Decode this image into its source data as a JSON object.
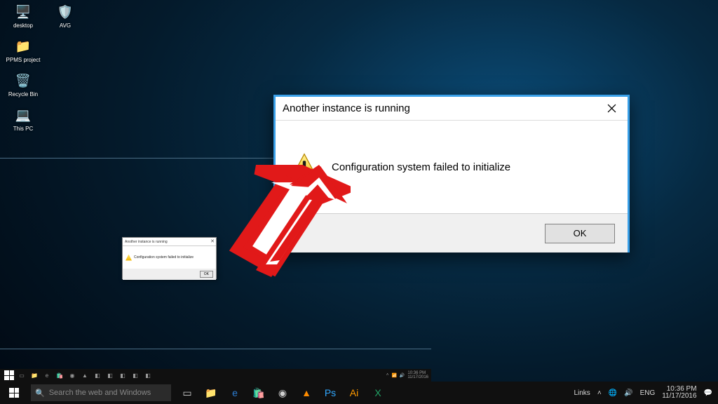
{
  "dialog": {
    "title": "Another instance is running",
    "message": "Configuration system failed to initialize",
    "ok_label": "OK"
  },
  "mini_dialog": {
    "title": "Another instance is running",
    "message": "Configuration system failed to initialize",
    "ok_label": "OK"
  },
  "desktop": {
    "col1": [
      "desktop",
      "PPMS project",
      "Recycle Bin",
      "This PC"
    ],
    "col2": [
      "AVG"
    ]
  },
  "outer_taskbar": {
    "search_placeholder": "Search the web and Windows",
    "tray": {
      "links": "Links",
      "lang": "ENG",
      "time": "10:36 PM",
      "date": "11/17/2016"
    }
  },
  "inner_taskbar": {
    "tray": {
      "time": "10:36 PM",
      "date": "11/17/2016"
    }
  },
  "colors": {
    "accent": "#3aa0e8",
    "arrow": "#e11919"
  }
}
